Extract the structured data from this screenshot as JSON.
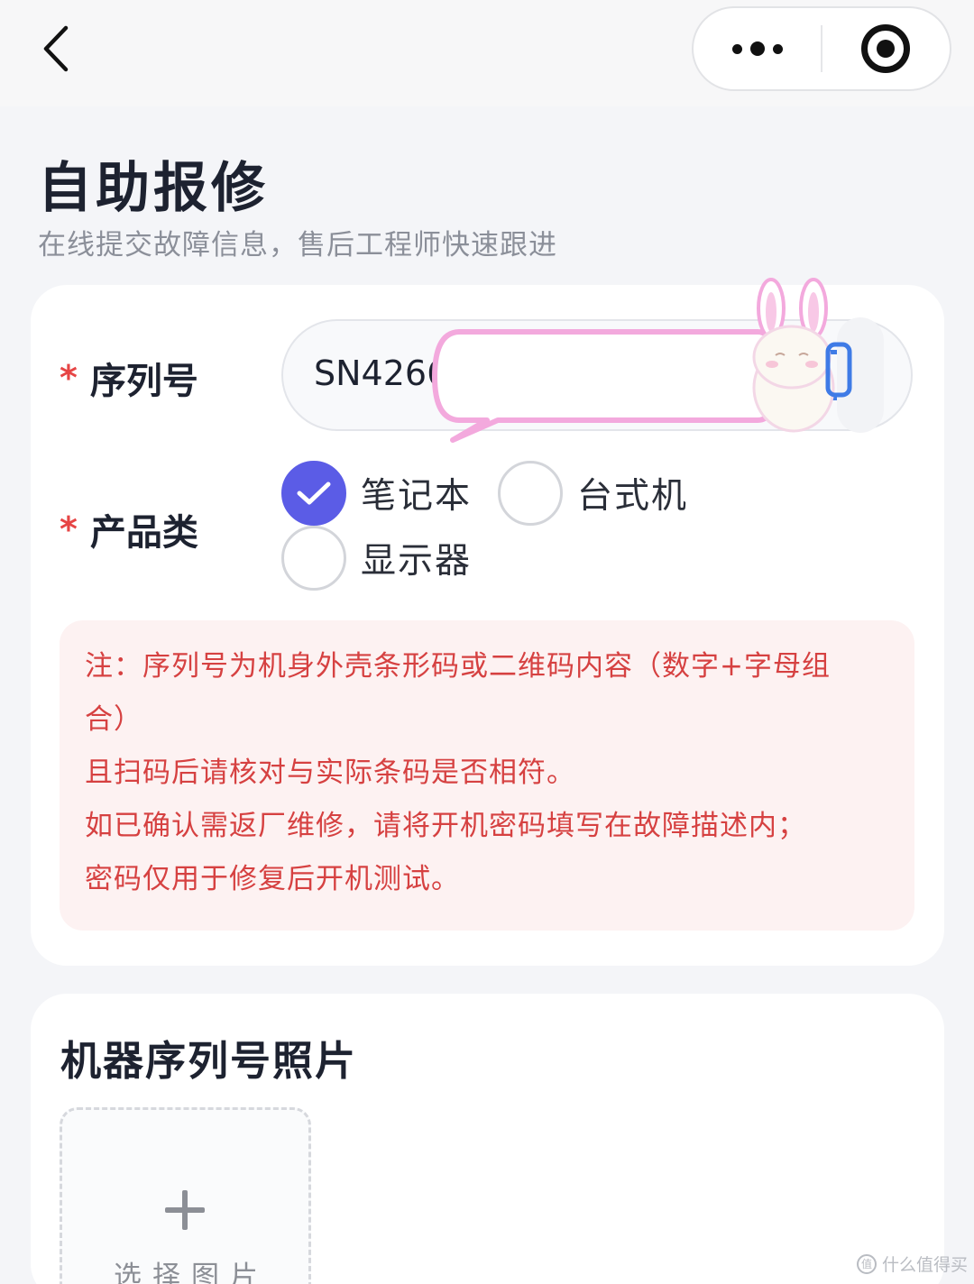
{
  "nav": {
    "back_icon": "chevron-left-icon",
    "more_icon": "more-dots-icon",
    "close_icon": "target-circle-icon"
  },
  "header": {
    "title": "自助报修",
    "subtitle": "在线提交故障信息，售后工程师快速跟进"
  },
  "form": {
    "serial": {
      "required_mark": "*",
      "label": "序列号",
      "value": "SN4266",
      "scan_icon": "scan-icon"
    },
    "product_type": {
      "required_mark": "*",
      "label": "产品类",
      "options": [
        {
          "label": "笔记本",
          "checked": true
        },
        {
          "label": "台式机",
          "checked": false
        },
        {
          "label": "显示器",
          "checked": false
        }
      ]
    },
    "notice": {
      "lines": [
        "注：序列号为机身外壳条形码或二维码内容（数字+字母组",
        "合）",
        "且扫码后请核对与实际条码是否相符。",
        "如已确认需返厂维修，请将开机密码填写在故障描述内；",
        "密码仅用于修复后开机测试。"
      ]
    }
  },
  "photo_section": {
    "title": "机器序列号照片",
    "upload_label": "选择图片",
    "upload_icon": "plus-icon"
  },
  "watermark": {
    "text": "什么值得买",
    "logo_glyph": "值"
  },
  "colors": {
    "accent": "#5b5ce6",
    "required": "#e64545",
    "notice_text": "#d64141",
    "notice_bg": "#fdf2f2",
    "scan_blue": "#3f7be6"
  }
}
